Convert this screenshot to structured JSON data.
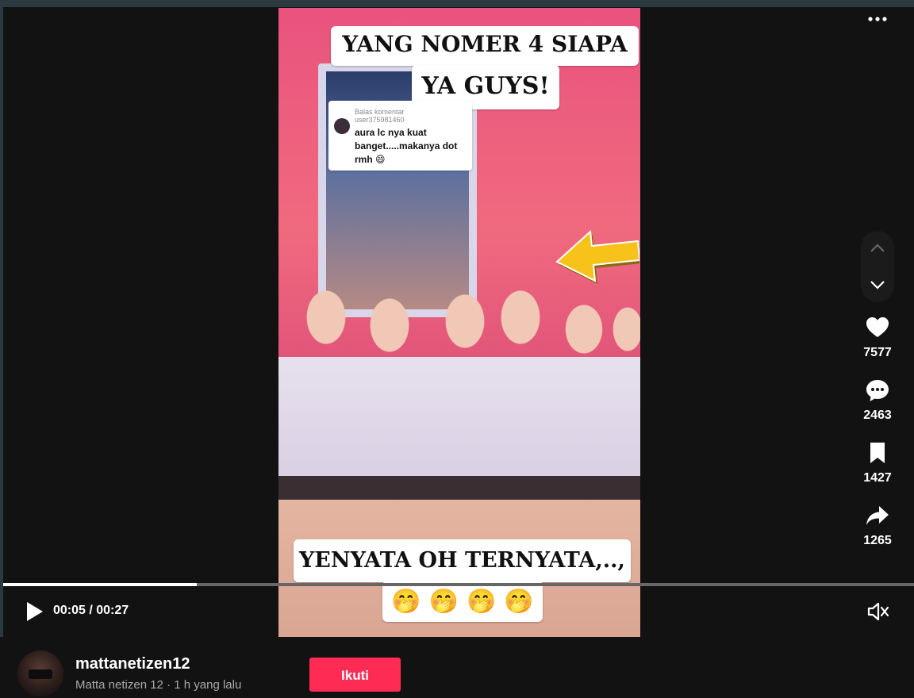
{
  "video": {
    "caption_top_line1": "YANG NOMER 4 SIAPA",
    "caption_top_line2": "YA GUYS!",
    "caption_bottom_line1": "YENYATA OH TERNYATA,..,",
    "caption_bottom_emojis": [
      "🤭",
      "🤭",
      "🤭",
      "🤭"
    ],
    "reply_label": "Balas komentar",
    "reply_user": "user375981460",
    "reply_text": "aura lc nya kuat banget.....makanya dot rmh 😄"
  },
  "sidebar": {
    "likes": "7577",
    "comments": "2463",
    "saves": "1427",
    "shares": "1265"
  },
  "player": {
    "time_display": "00:05 / 00:27",
    "progress_fraction": 0.2127
  },
  "author": {
    "username": "mattanetizen12",
    "meta": "Matta netizen 12 · 1 h yang lalu",
    "follow_label": "Ikuti"
  },
  "colors": {
    "accent": "#fe2c55",
    "background": "#121212",
    "arrow": "#f7c31b"
  },
  "icons": [
    "more-icon",
    "chevron-up-icon",
    "chevron-down-icon",
    "heart-icon",
    "comment-icon",
    "bookmark-icon",
    "share-icon",
    "play-icon",
    "volume-icon"
  ]
}
